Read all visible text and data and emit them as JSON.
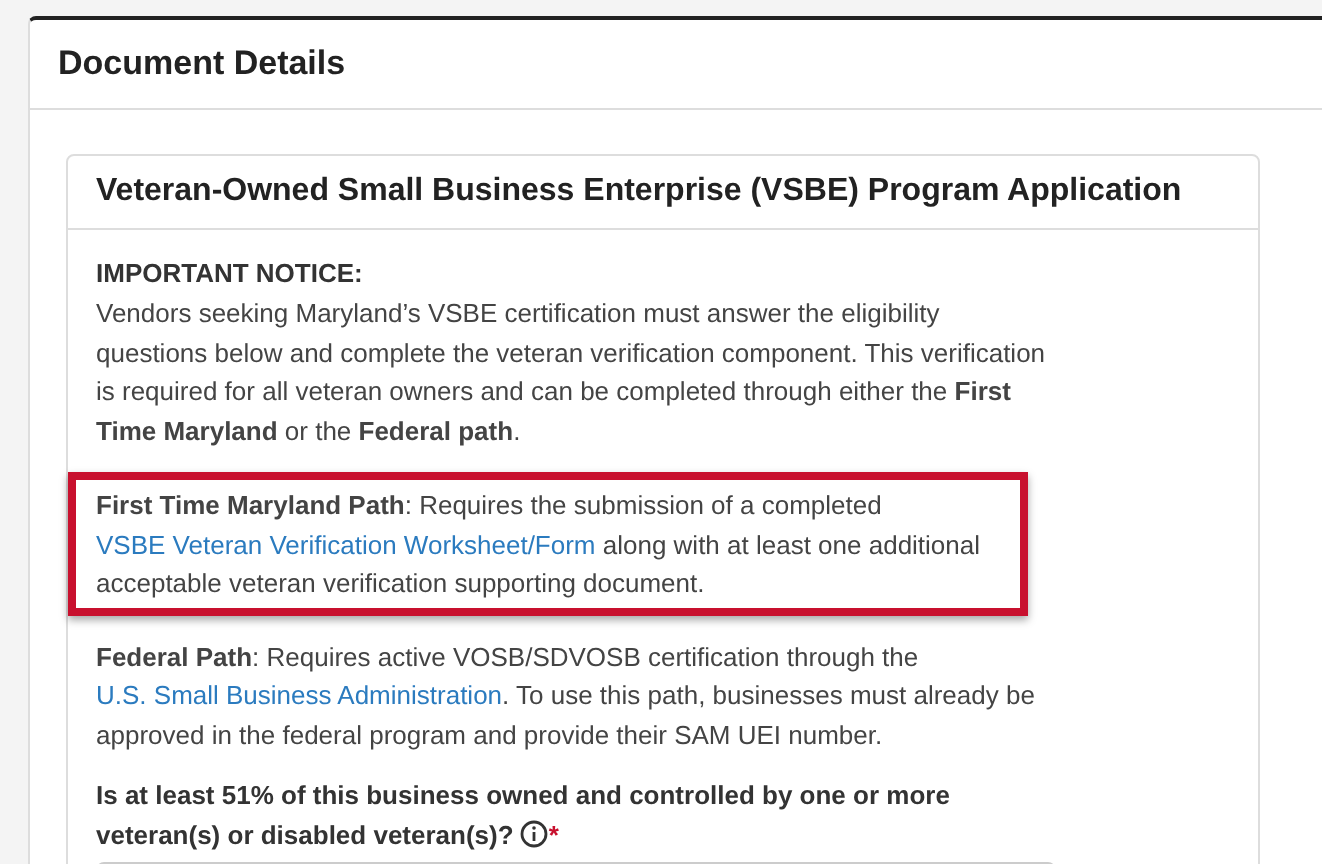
{
  "panel": {
    "title": "Document Details"
  },
  "card": {
    "title": "Veteran-Owned Small Business Enterprise (VSBE) Program Application"
  },
  "notice_heading": "IMPORTANT NOTICE:",
  "paragraphs": [
    {
      "highlighted": false,
      "segments": [
        {
          "kind": "text",
          "text": "Vendors seeking Maryland’s VSBE certification must answer the eligibility questions below and complete the veteran verification component. This verification is required for all veteran owners and can be completed through either the "
        },
        {
          "kind": "bold",
          "text": "First Time Maryland"
        },
        {
          "kind": "text",
          "text": " or the "
        },
        {
          "kind": "bold",
          "text": "Federal path"
        },
        {
          "kind": "text",
          "text": "."
        }
      ]
    },
    {
      "highlighted": true,
      "segments": [
        {
          "kind": "bold",
          "text": "First Time Maryland Path"
        },
        {
          "kind": "text",
          "text": ": Requires the submission of a completed "
        },
        {
          "kind": "link",
          "text": "VSBE Veteran Verification Worksheet/Form"
        },
        {
          "kind": "text",
          "text": " along with at least one additional acceptable veteran verification supporting document."
        }
      ]
    },
    {
      "highlighted": false,
      "segments": [
        {
          "kind": "bold",
          "text": "Federal Path"
        },
        {
          "kind": "text",
          "text": ": Requires active VOSB/SDVOSB certification through the "
        },
        {
          "kind": "link",
          "text": "U.S. Small Business Administration"
        },
        {
          "kind": "text",
          "text": ". To use this path, businesses must already be approved in the federal program and provide their SAM UEI number."
        }
      ]
    }
  ],
  "question": {
    "label": "Is at least 51% of this business owned and controlled by one or more veteran(s) or disabled veteran(s)?",
    "required": true,
    "required_mark": "*"
  }
}
